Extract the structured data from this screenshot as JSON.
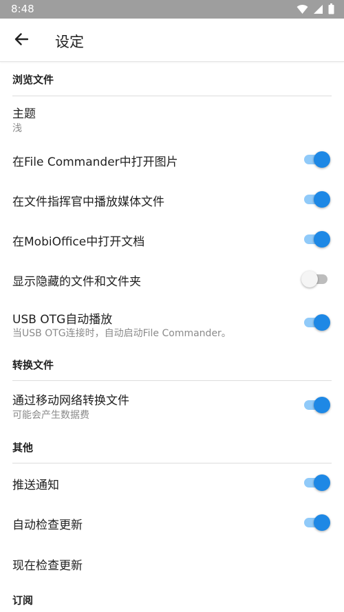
{
  "status_bar": {
    "time": "8:48"
  },
  "app_bar": {
    "title": "设定"
  },
  "sections": {
    "browse": {
      "header": "浏览文件"
    },
    "convert": {
      "header": "转换文件"
    },
    "other": {
      "header": "其他"
    },
    "subscribe": {
      "header": "订阅"
    }
  },
  "items": {
    "theme": {
      "title": "主题",
      "subtitle": "浅"
    },
    "open_images": {
      "title": "在File Commander中打开图片",
      "enabled": true
    },
    "play_media": {
      "title": "在文件指挥官中播放媒体文件",
      "enabled": true
    },
    "open_docs": {
      "title": "在MobiOffice中打开文档",
      "enabled": true
    },
    "show_hidden": {
      "title": "显示隐藏的文件和文件夹",
      "enabled": false
    },
    "usb_otg": {
      "title": "USB OTG自动播放",
      "subtitle": "当USB OTG连接时，自动启动File Commander。",
      "enabled": true
    },
    "mobile_convert": {
      "title": "通过移动网络转换文件",
      "subtitle": "可能会产生数据费",
      "enabled": true
    },
    "push": {
      "title": "推送通知",
      "enabled": true
    },
    "auto_update": {
      "title": "自动检查更新",
      "enabled": true
    },
    "check_now": {
      "title": "现在检查更新"
    }
  },
  "colors": {
    "accent": "#1e88e5",
    "accent_track": "#90caf9",
    "status_bar": "#9e9e9e"
  },
  "icons": {
    "back": "arrow-back-icon",
    "wifi": "wifi-icon",
    "signal": "signal-icon",
    "battery": "battery-icon"
  }
}
